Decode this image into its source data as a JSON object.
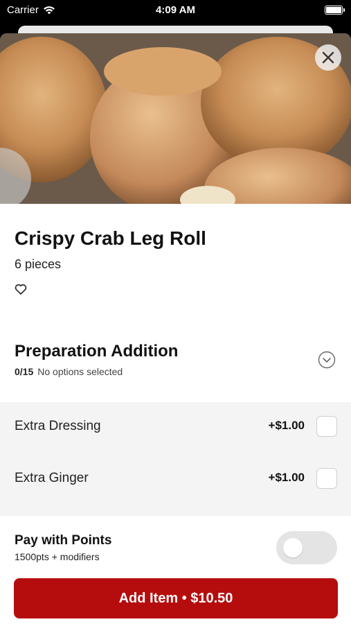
{
  "status_bar": {
    "carrier": "Carrier",
    "time": "4:09 AM"
  },
  "item": {
    "title": "Crispy Crab Leg Roll",
    "subtitle": "6 pieces",
    "hero_image_alt": "Crispy Crab Leg Roll"
  },
  "preparation": {
    "title": "Preparation Addition",
    "count": "0/15",
    "status": "No options selected",
    "options": [
      {
        "label": "Extra Dressing",
        "price": "+$1.00",
        "checked": false
      },
      {
        "label": "Extra Ginger",
        "price": "+$1.00",
        "checked": false
      }
    ]
  },
  "points": {
    "label": "Pay with Points",
    "sub": "1500pts + modifiers",
    "enabled": false
  },
  "add_button": {
    "label": "Add Item • $10.50"
  },
  "colors": {
    "accent": "#b50d0d",
    "options_bg": "#f4f4f4",
    "toggle_off": "#e4e4e4"
  },
  "icons": {
    "close": "close-icon",
    "favorite": "heart-icon",
    "expand": "chevron-down-icon",
    "wifi": "wifi-icon",
    "battery": "battery-icon"
  }
}
